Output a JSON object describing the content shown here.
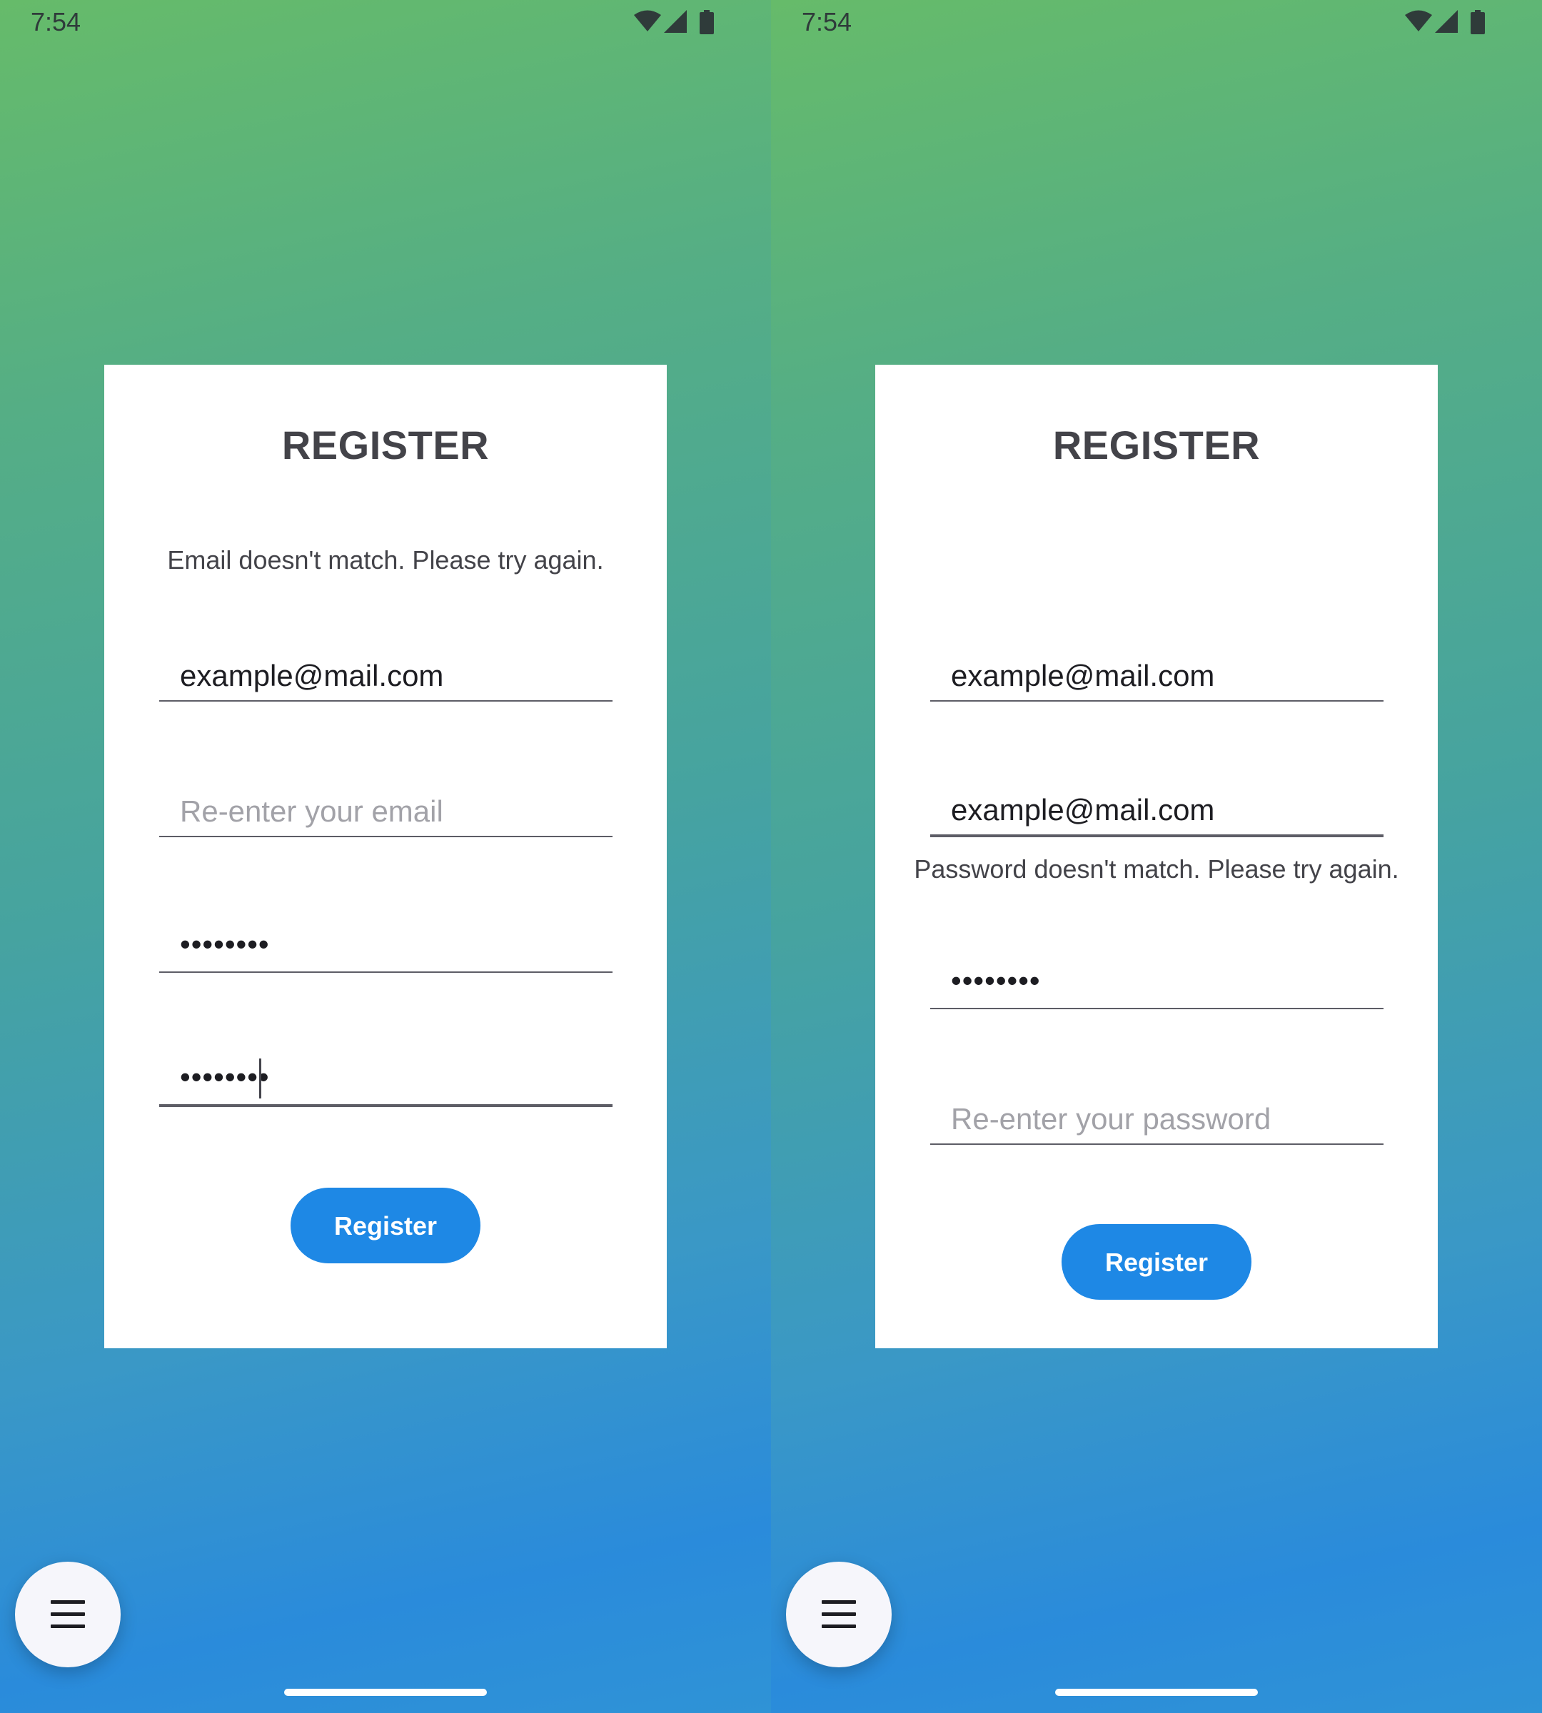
{
  "screens": [
    {
      "status_bar": {
        "time": "7:54",
        "icons": [
          "wifi-icon",
          "signal-icon",
          "battery-icon"
        ]
      },
      "card": {
        "title": "REGISTER",
        "error_message": "Email doesn't match. Please try again.",
        "fields": {
          "email": {
            "value": "example@mail.com",
            "placeholder": ""
          },
          "confirm_email": {
            "value": "",
            "placeholder": "Re-enter your email"
          },
          "password": {
            "value": "••••••••"
          },
          "confirm_password": {
            "value": "••••••••",
            "focused": true
          }
        },
        "register_label": "Register"
      },
      "fab_icon": "menu-icon"
    },
    {
      "status_bar": {
        "time": "7:54",
        "icons": [
          "wifi-icon",
          "signal-icon",
          "battery-icon"
        ]
      },
      "card": {
        "title": "REGISTER",
        "error_message": "Password doesn't match. Please try again.",
        "fields": {
          "email": {
            "value": "example@mail.com"
          },
          "confirm_email": {
            "value": "example@mail.com",
            "focused": true
          },
          "password": {
            "value": "••••••••"
          },
          "confirm_password": {
            "value": "",
            "placeholder": "Re-enter your password"
          }
        },
        "register_label": "Register"
      },
      "fab_icon": "menu-icon"
    }
  ],
  "colors": {
    "gradient_top": "#66bb6a",
    "gradient_bottom": "#2a8bdb",
    "button": "#1e88e5",
    "card": "#ffffff",
    "text_dark": "#434349"
  }
}
